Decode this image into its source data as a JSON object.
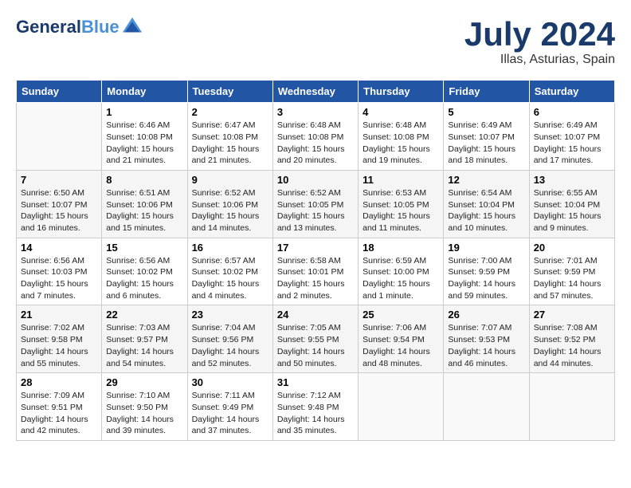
{
  "header": {
    "logo_line1": "General",
    "logo_line2": "Blue",
    "month": "July 2024",
    "location": "Illas, Asturias, Spain"
  },
  "weekdays": [
    "Sunday",
    "Monday",
    "Tuesday",
    "Wednesday",
    "Thursday",
    "Friday",
    "Saturday"
  ],
  "weeks": [
    [
      {
        "day": "",
        "info": ""
      },
      {
        "day": "1",
        "info": "Sunrise: 6:46 AM\nSunset: 10:08 PM\nDaylight: 15 hours\nand 21 minutes."
      },
      {
        "day": "2",
        "info": "Sunrise: 6:47 AM\nSunset: 10:08 PM\nDaylight: 15 hours\nand 21 minutes."
      },
      {
        "day": "3",
        "info": "Sunrise: 6:48 AM\nSunset: 10:08 PM\nDaylight: 15 hours\nand 20 minutes."
      },
      {
        "day": "4",
        "info": "Sunrise: 6:48 AM\nSunset: 10:08 PM\nDaylight: 15 hours\nand 19 minutes."
      },
      {
        "day": "5",
        "info": "Sunrise: 6:49 AM\nSunset: 10:07 PM\nDaylight: 15 hours\nand 18 minutes."
      },
      {
        "day": "6",
        "info": "Sunrise: 6:49 AM\nSunset: 10:07 PM\nDaylight: 15 hours\nand 17 minutes."
      }
    ],
    [
      {
        "day": "7",
        "info": "Sunrise: 6:50 AM\nSunset: 10:07 PM\nDaylight: 15 hours\nand 16 minutes."
      },
      {
        "day": "8",
        "info": "Sunrise: 6:51 AM\nSunset: 10:06 PM\nDaylight: 15 hours\nand 15 minutes."
      },
      {
        "day": "9",
        "info": "Sunrise: 6:52 AM\nSunset: 10:06 PM\nDaylight: 15 hours\nand 14 minutes."
      },
      {
        "day": "10",
        "info": "Sunrise: 6:52 AM\nSunset: 10:05 PM\nDaylight: 15 hours\nand 13 minutes."
      },
      {
        "day": "11",
        "info": "Sunrise: 6:53 AM\nSunset: 10:05 PM\nDaylight: 15 hours\nand 11 minutes."
      },
      {
        "day": "12",
        "info": "Sunrise: 6:54 AM\nSunset: 10:04 PM\nDaylight: 15 hours\nand 10 minutes."
      },
      {
        "day": "13",
        "info": "Sunrise: 6:55 AM\nSunset: 10:04 PM\nDaylight: 15 hours\nand 9 minutes."
      }
    ],
    [
      {
        "day": "14",
        "info": "Sunrise: 6:56 AM\nSunset: 10:03 PM\nDaylight: 15 hours\nand 7 minutes."
      },
      {
        "day": "15",
        "info": "Sunrise: 6:56 AM\nSunset: 10:02 PM\nDaylight: 15 hours\nand 6 minutes."
      },
      {
        "day": "16",
        "info": "Sunrise: 6:57 AM\nSunset: 10:02 PM\nDaylight: 15 hours\nand 4 minutes."
      },
      {
        "day": "17",
        "info": "Sunrise: 6:58 AM\nSunset: 10:01 PM\nDaylight: 15 hours\nand 2 minutes."
      },
      {
        "day": "18",
        "info": "Sunrise: 6:59 AM\nSunset: 10:00 PM\nDaylight: 15 hours\nand 1 minute."
      },
      {
        "day": "19",
        "info": "Sunrise: 7:00 AM\nSunset: 9:59 PM\nDaylight: 14 hours\nand 59 minutes."
      },
      {
        "day": "20",
        "info": "Sunrise: 7:01 AM\nSunset: 9:59 PM\nDaylight: 14 hours\nand 57 minutes."
      }
    ],
    [
      {
        "day": "21",
        "info": "Sunrise: 7:02 AM\nSunset: 9:58 PM\nDaylight: 14 hours\nand 55 minutes."
      },
      {
        "day": "22",
        "info": "Sunrise: 7:03 AM\nSunset: 9:57 PM\nDaylight: 14 hours\nand 54 minutes."
      },
      {
        "day": "23",
        "info": "Sunrise: 7:04 AM\nSunset: 9:56 PM\nDaylight: 14 hours\nand 52 minutes."
      },
      {
        "day": "24",
        "info": "Sunrise: 7:05 AM\nSunset: 9:55 PM\nDaylight: 14 hours\nand 50 minutes."
      },
      {
        "day": "25",
        "info": "Sunrise: 7:06 AM\nSunset: 9:54 PM\nDaylight: 14 hours\nand 48 minutes."
      },
      {
        "day": "26",
        "info": "Sunrise: 7:07 AM\nSunset: 9:53 PM\nDaylight: 14 hours\nand 46 minutes."
      },
      {
        "day": "27",
        "info": "Sunrise: 7:08 AM\nSunset: 9:52 PM\nDaylight: 14 hours\nand 44 minutes."
      }
    ],
    [
      {
        "day": "28",
        "info": "Sunrise: 7:09 AM\nSunset: 9:51 PM\nDaylight: 14 hours\nand 42 minutes."
      },
      {
        "day": "29",
        "info": "Sunrise: 7:10 AM\nSunset: 9:50 PM\nDaylight: 14 hours\nand 39 minutes."
      },
      {
        "day": "30",
        "info": "Sunrise: 7:11 AM\nSunset: 9:49 PM\nDaylight: 14 hours\nand 37 minutes."
      },
      {
        "day": "31",
        "info": "Sunrise: 7:12 AM\nSunset: 9:48 PM\nDaylight: 14 hours\nand 35 minutes."
      },
      {
        "day": "",
        "info": ""
      },
      {
        "day": "",
        "info": ""
      },
      {
        "day": "",
        "info": ""
      }
    ]
  ]
}
